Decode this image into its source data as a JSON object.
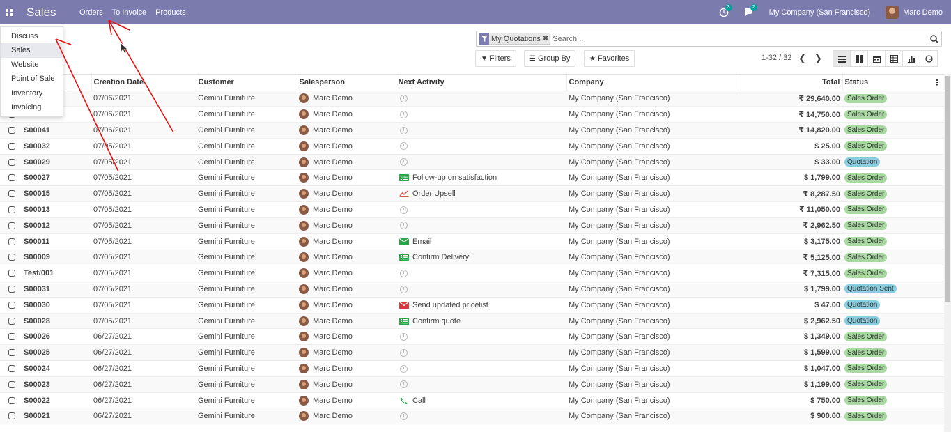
{
  "navbar": {
    "brand": "Sales",
    "menu": [
      "Orders",
      "To Invoice",
      "Products"
    ],
    "activity_badge": "3",
    "messages_badge": "2",
    "company": "My Company (San Francisco)",
    "user": "Marc Demo"
  },
  "apps_menu": {
    "items": [
      "Discuss",
      "Sales",
      "Website",
      "Point of Sale",
      "Inventory",
      "Invoicing"
    ],
    "active": "Sales"
  },
  "search": {
    "facet": "My Quotations",
    "placeholder": "Search..."
  },
  "controls": {
    "filters": "Filters",
    "group_by": "Group By",
    "favorites": "Favorites",
    "pager": "1-32 / 32"
  },
  "table": {
    "columns": [
      "Creation Date",
      "Customer",
      "Salesperson",
      "Next Activity",
      "Company",
      "Total",
      "Status"
    ],
    "rows": [
      {
        "ref": "",
        "date": "07/06/2021",
        "customer": "Gemini Furniture",
        "salesperson": "Marc Demo",
        "activity": "",
        "activity_icon": "",
        "company": "My Company (San Francisco)",
        "total": "₹ 29,640.00",
        "status": "Sales Order"
      },
      {
        "ref": "",
        "date": "07/06/2021",
        "customer": "Gemini Furniture",
        "salesperson": "Marc Demo",
        "activity": "",
        "activity_icon": "",
        "company": "My Company (San Francisco)",
        "total": "₹ 14,750.00",
        "status": "Sales Order"
      },
      {
        "ref": "S00041",
        "date": "07/06/2021",
        "customer": "Gemini Furniture",
        "salesperson": "Marc Demo",
        "activity": "",
        "activity_icon": "",
        "company": "My Company (San Francisco)",
        "total": "₹ 14,820.00",
        "status": "Sales Order"
      },
      {
        "ref": "S00032",
        "date": "07/05/2021",
        "customer": "Gemini Furniture",
        "salesperson": "Marc Demo",
        "activity": "",
        "activity_icon": "",
        "company": "My Company (San Francisco)",
        "total": "$ 25.00",
        "status": "Sales Order"
      },
      {
        "ref": "S00029",
        "date": "07/05/2021",
        "customer": "Gemini Furniture",
        "salesperson": "Marc Demo",
        "activity": "",
        "activity_icon": "",
        "company": "My Company (San Francisco)",
        "total": "$ 33.00",
        "status": "Quotation"
      },
      {
        "ref": "S00027",
        "date": "07/05/2021",
        "customer": "Gemini Furniture",
        "salesperson": "Marc Demo",
        "activity": "Follow-up on satisfaction",
        "activity_icon": "tasks-icon",
        "company": "My Company (San Francisco)",
        "total": "$ 1,799.00",
        "status": "Sales Order"
      },
      {
        "ref": "S00015",
        "date": "07/05/2021",
        "customer": "Gemini Furniture",
        "salesperson": "Marc Demo",
        "activity": "Order Upsell",
        "activity_icon": "trend-icon",
        "company": "My Company (San Francisco)",
        "total": "₹ 8,287.50",
        "status": "Sales Order"
      },
      {
        "ref": "S00013",
        "date": "07/05/2021",
        "customer": "Gemini Furniture",
        "salesperson": "Marc Demo",
        "activity": "",
        "activity_icon": "",
        "company": "My Company (San Francisco)",
        "total": "₹ 11,050.00",
        "status": "Sales Order"
      },
      {
        "ref": "S00012",
        "date": "07/05/2021",
        "customer": "Gemini Furniture",
        "salesperson": "Marc Demo",
        "activity": "",
        "activity_icon": "",
        "company": "My Company (San Francisco)",
        "total": "₹ 2,962.50",
        "status": "Sales Order"
      },
      {
        "ref": "S00011",
        "date": "07/05/2021",
        "customer": "Gemini Furniture",
        "salesperson": "Marc Demo",
        "activity": "Email",
        "activity_icon": "email-green-icon",
        "company": "My Company (San Francisco)",
        "total": "$ 3,175.00",
        "status": "Sales Order"
      },
      {
        "ref": "S00009",
        "date": "07/05/2021",
        "customer": "Gemini Furniture",
        "salesperson": "Marc Demo",
        "activity": "Confirm Delivery",
        "activity_icon": "tasks-icon",
        "company": "My Company (San Francisco)",
        "total": "₹ 5,125.00",
        "status": "Sales Order"
      },
      {
        "ref": "Test/001",
        "date": "07/05/2021",
        "customer": "Gemini Furniture",
        "salesperson": "Marc Demo",
        "activity": "",
        "activity_icon": "",
        "company": "My Company (San Francisco)",
        "total": "₹ 7,315.00",
        "status": "Sales Order"
      },
      {
        "ref": "S00031",
        "date": "07/05/2021",
        "customer": "Gemini Furniture",
        "salesperson": "Marc Demo",
        "activity": "",
        "activity_icon": "",
        "company": "My Company (San Francisco)",
        "total": "$ 1,799.00",
        "status": "Quotation Sent"
      },
      {
        "ref": "S00030",
        "date": "07/05/2021",
        "customer": "Gemini Furniture",
        "salesperson": "Marc Demo",
        "activity": "Send updated pricelist",
        "activity_icon": "email-red-icon",
        "company": "My Company (San Francisco)",
        "total": "$ 47.00",
        "status": "Quotation"
      },
      {
        "ref": "S00028",
        "date": "07/05/2021",
        "customer": "Gemini Furniture",
        "salesperson": "Marc Demo",
        "activity": "Confirm quote",
        "activity_icon": "tasks-icon",
        "company": "My Company (San Francisco)",
        "total": "$ 2,962.50",
        "status": "Quotation"
      },
      {
        "ref": "S00026",
        "date": "06/27/2021",
        "customer": "Gemini Furniture",
        "salesperson": "Marc Demo",
        "activity": "",
        "activity_icon": "",
        "company": "My Company (San Francisco)",
        "total": "$ 1,349.00",
        "status": "Sales Order"
      },
      {
        "ref": "S00025",
        "date": "06/27/2021",
        "customer": "Gemini Furniture",
        "salesperson": "Marc Demo",
        "activity": "",
        "activity_icon": "",
        "company": "My Company (San Francisco)",
        "total": "$ 1,599.00",
        "status": "Sales Order"
      },
      {
        "ref": "S00024",
        "date": "06/27/2021",
        "customer": "Gemini Furniture",
        "salesperson": "Marc Demo",
        "activity": "",
        "activity_icon": "",
        "company": "My Company (San Francisco)",
        "total": "$ 1,047.00",
        "status": "Sales Order"
      },
      {
        "ref": "S00023",
        "date": "06/27/2021",
        "customer": "Gemini Furniture",
        "salesperson": "Marc Demo",
        "activity": "",
        "activity_icon": "",
        "company": "My Company (San Francisco)",
        "total": "$ 1,199.00",
        "status": "Sales Order"
      },
      {
        "ref": "S00022",
        "date": "06/27/2021",
        "customer": "Gemini Furniture",
        "salesperson": "Marc Demo",
        "activity": "Call",
        "activity_icon": "phone-icon",
        "company": "My Company (San Francisco)",
        "total": "$ 750.00",
        "status": "Sales Order"
      },
      {
        "ref": "S00021",
        "date": "06/27/2021",
        "customer": "Gemini Furniture",
        "salesperson": "Marc Demo",
        "activity": "",
        "activity_icon": "",
        "company": "My Company (San Francisco)",
        "total": "$ 900.00",
        "status": "Sales Order"
      }
    ]
  }
}
